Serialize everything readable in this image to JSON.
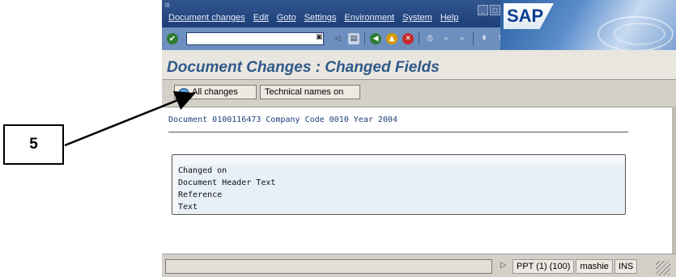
{
  "annotation": {
    "callout_number": "5"
  },
  "menubar": {
    "items": [
      "Document changes",
      "Edit",
      "Goto",
      "Settings",
      "Environment",
      "System",
      "Help"
    ]
  },
  "toolbar": {
    "command_field_value": ""
  },
  "brand": {
    "logo_text": "SAP"
  },
  "page": {
    "title": "Document Changes : Changed Fields"
  },
  "app_toolbar": {
    "all_changes_label": "All changes",
    "technical_names_label": "Technical names on"
  },
  "content": {
    "document_line": "Document 0100116473 Company Code 0010 Year 2004",
    "changed_fields": [
      "Changed on",
      "Document Header Text",
      "Reference",
      "Text"
    ]
  },
  "status": {
    "system": "PPT (1) (100)",
    "server": "mashie",
    "mode": "INS"
  },
  "colors": {
    "title": "#2f5a8a",
    "menubar": "#1d3f78",
    "toolbar": "#6d8fbf"
  }
}
